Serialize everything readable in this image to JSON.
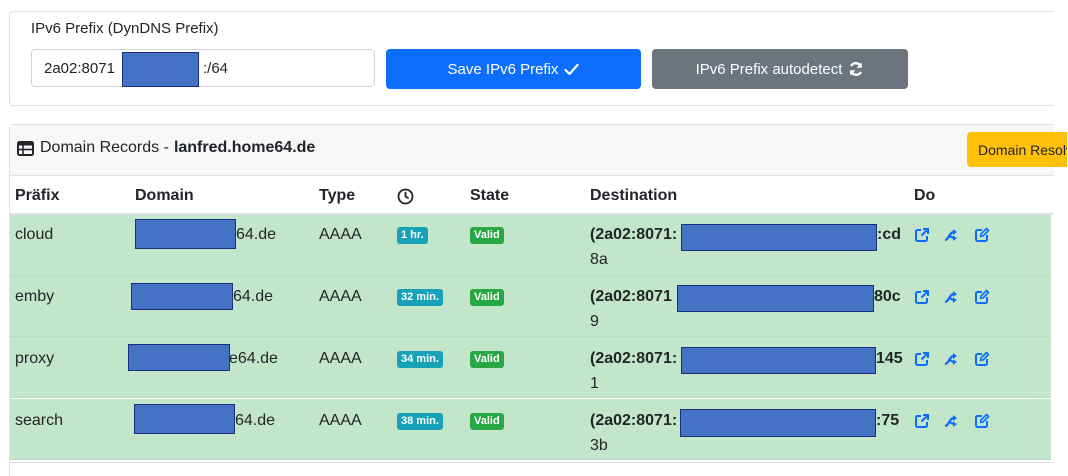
{
  "prefix": {
    "label": "IPv6 Prefix (DynDNS Prefix)",
    "value_start": "2a02:8071",
    "value_end": ":/64",
    "save_label": "Save IPv6 Prefix",
    "autodetect_label": "IPv6 Prefix autodetect"
  },
  "records": {
    "title": "Domain Records -",
    "host": "lanfred.home64.de",
    "resolve_label": "Domain Resolve",
    "columns": {
      "prefix": "Präfix",
      "domain": "Domain",
      "type": "Type",
      "state": "State",
      "destination": "Destination",
      "do": "Do"
    },
    "rows": [
      {
        "prefix": "cloud",
        "domain": "64.de",
        "type": "AAAA",
        "age": "1 hr.",
        "state": "Valid",
        "dest_start": "(2a02:8071:",
        "dest_end": ":cd",
        "dest_wrap": "8a"
      },
      {
        "prefix": "emby",
        "domain": "64.de",
        "type": "AAAA",
        "age": "32 min.",
        "state": "Valid",
        "dest_start": "(2a02:8071",
        "dest_end": "80c",
        "dest_wrap": "9"
      },
      {
        "prefix": "proxy",
        "domain": "e64.de",
        "type": "AAAA",
        "age": "34 min.",
        "state": "Valid",
        "dest_start": "(2a02:8071:",
        "dest_end": "145",
        "dest_wrap": "1"
      },
      {
        "prefix": "search",
        "domain": "64.de",
        "type": "AAAA",
        "age": "38 min.",
        "state": "Valid",
        "dest_start": "(2a02:8071:",
        "dest_end": ":75",
        "dest_wrap": "3b"
      }
    ]
  },
  "colors": {
    "primary": "#0d6efd",
    "secondary": "#6c757d",
    "warning": "#ffc107",
    "success_row": "#c3e6cb",
    "info_badge": "#17a2b8",
    "success_badge": "#28a745",
    "redaction": "#4472c4"
  },
  "icons": {
    "table": "table-icon",
    "check": "check-icon",
    "refresh": "refresh-icon",
    "clock": "clock-icon",
    "external": "external-link-icon",
    "shuffle": "shuffle-icon",
    "edit": "edit-icon"
  }
}
